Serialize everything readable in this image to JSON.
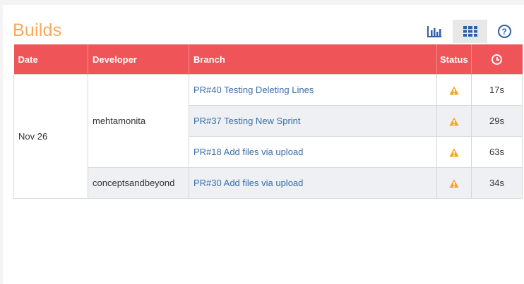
{
  "title": "Builds",
  "toolbar": {
    "chart_icon": "bar-chart-icon",
    "grid_icon": "grid-icon",
    "help_icon": "help-icon",
    "help_glyph": "?"
  },
  "table": {
    "headers": {
      "date": "Date",
      "developer": "Developer",
      "branch": "Branch",
      "status": "Status",
      "duration_icon": "clock-icon"
    },
    "groups": {
      "date": "Nov 26",
      "dev1": "mehtamonita",
      "dev2": "conceptsandbeyond"
    },
    "rows": [
      {
        "branch": "PR#40 Testing Deleting Lines",
        "status": "warning-icon",
        "duration": "17s"
      },
      {
        "branch": "PR#37 Testing New Sprint",
        "status": "warning-icon",
        "duration": "29s"
      },
      {
        "branch": "PR#18 Add files via upload",
        "status": "warning-icon",
        "duration": "63s"
      },
      {
        "branch": "PR#30 Add files via upload",
        "status": "warning-icon",
        "duration": "34s"
      }
    ]
  },
  "colors": {
    "title": "#f6a95c",
    "header_bg": "#ef5458",
    "link": "#3a6ea8",
    "warning": "#f5a623",
    "icon_blue": "#2f5fa8"
  }
}
